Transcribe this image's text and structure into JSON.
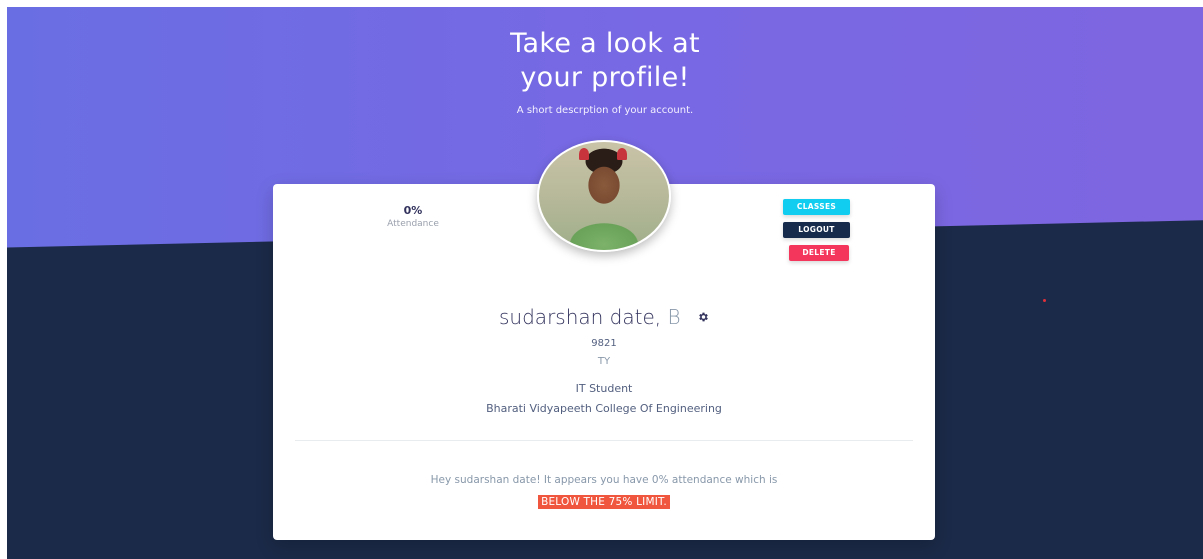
{
  "hero": {
    "title_line1": "Take a look at",
    "title_line2": "your profile!",
    "subtitle": "A short descrption of your account."
  },
  "stats": {
    "attendance_value": "0%",
    "attendance_label": "Attendance"
  },
  "avatar": {
    "alt": "Profile photo"
  },
  "actions": {
    "classes_label": "CLASSES",
    "logout_label": "LOGOUT",
    "delete_label": "DELETE"
  },
  "profile": {
    "name": "sudarshan date",
    "separator": ",",
    "initial": "B",
    "roll_number": "9821",
    "year": "TY",
    "role": "IT Student",
    "college": "Bharati Vidyapeeth College Of Engineering"
  },
  "notice": {
    "message": "Hey sudarshan date! It appears you have 0% attendance which is",
    "warning": "BELOW THE 75% LIMIT."
  },
  "colors": {
    "hero_gradient_start": "#6a6ee3",
    "hero_gradient_end": "#7e66e0",
    "page_dark": "#1b2a48",
    "classes_button": "#11cdef",
    "logout_button": "#172b4d",
    "delete_button": "#f5365c",
    "warning_highlight": "#f0563d"
  }
}
